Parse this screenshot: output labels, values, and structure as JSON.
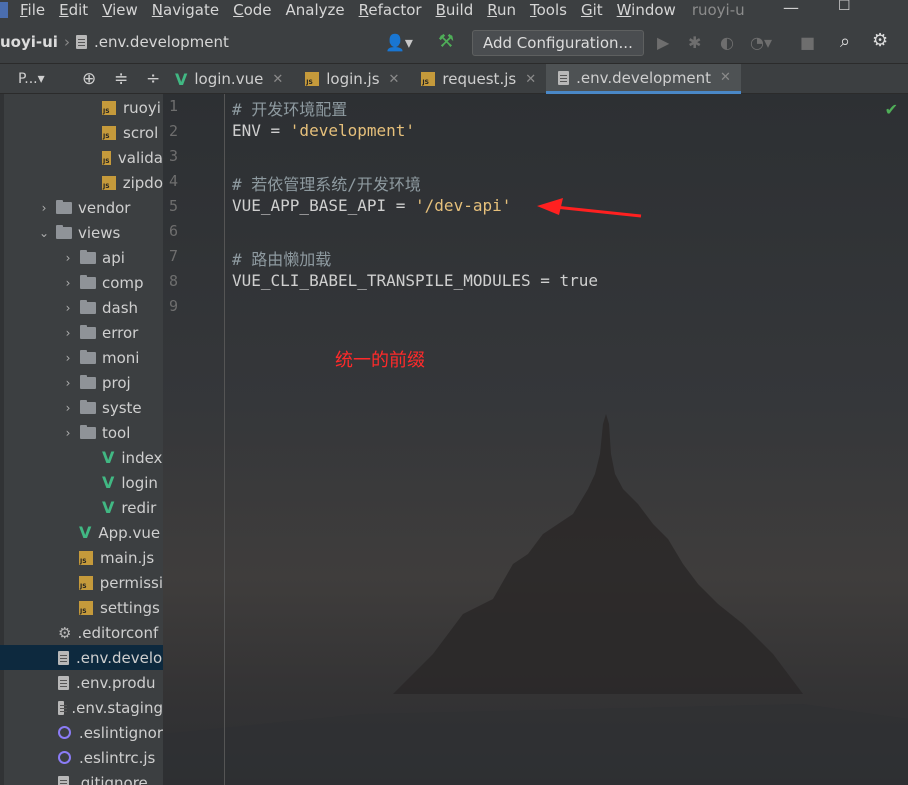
{
  "menubar": {
    "items": [
      {
        "label": "File",
        "u": "F",
        "rest": "ile"
      },
      {
        "label": "Edit",
        "u": "E",
        "rest": "dit"
      },
      {
        "label": "View",
        "u": "V",
        "rest": "iew"
      },
      {
        "label": "Navigate",
        "u": "N",
        "rest": "avigate"
      },
      {
        "label": "Code",
        "u": "C",
        "rest": "ode"
      },
      {
        "label": "Analyze",
        "u": "",
        "rest": "Analyze"
      },
      {
        "label": "Refactor",
        "u": "R",
        "rest": "efactor"
      },
      {
        "label": "Build",
        "u": "B",
        "rest": "uild"
      },
      {
        "label": "Run",
        "u": "R",
        "rest": "un"
      },
      {
        "label": "Tools",
        "u": "T",
        "rest": "ools"
      },
      {
        "label": "Git",
        "u": "G",
        "rest": "it"
      },
      {
        "label": "Window",
        "u": "W",
        "rest": "indow"
      }
    ],
    "project_title": "ruoyi-u"
  },
  "navbar": {
    "project": "uoyi-ui",
    "file": ".env.development",
    "config_button": "Add Configuration..."
  },
  "project_panel": {
    "tab_label": "P..."
  },
  "tabs": [
    {
      "label": "login.vue",
      "type": "vue"
    },
    {
      "label": "login.js",
      "type": "js"
    },
    {
      "label": "request.js",
      "type": "js"
    },
    {
      "label": ".env.development",
      "type": "file",
      "active": true
    }
  ],
  "tree": [
    {
      "label": "ruoyi",
      "type": "js",
      "indent": 3
    },
    {
      "label": "scrol",
      "type": "js",
      "indent": 3
    },
    {
      "label": "valida",
      "type": "js",
      "indent": 3
    },
    {
      "label": "zipdo",
      "type": "js",
      "indent": 3
    },
    {
      "label": "vendor",
      "type": "folder",
      "indent": 2,
      "arrow": "›"
    },
    {
      "label": "views",
      "type": "folder",
      "indent": 2,
      "arrow": "⌄"
    },
    {
      "label": "api",
      "type": "folder",
      "indent": 3,
      "arrow": "›"
    },
    {
      "label": "comp",
      "type": "folder",
      "indent": 3,
      "arrow": "›"
    },
    {
      "label": "dash",
      "type": "folder",
      "indent": 3,
      "arrow": "›"
    },
    {
      "label": "error",
      "type": "folder",
      "indent": 3,
      "arrow": "›"
    },
    {
      "label": "moni",
      "type": "folder",
      "indent": 3,
      "arrow": "›"
    },
    {
      "label": "proj",
      "type": "folder",
      "indent": 3,
      "arrow": "›"
    },
    {
      "label": "syste",
      "type": "folder",
      "indent": 3,
      "arrow": "›"
    },
    {
      "label": "tool",
      "type": "folder",
      "indent": 3,
      "arrow": "›"
    },
    {
      "label": "index",
      "type": "vue",
      "indent": 3
    },
    {
      "label": "login",
      "type": "vue",
      "indent": 3
    },
    {
      "label": "redir",
      "type": "vue",
      "indent": 3
    },
    {
      "label": "App.vue",
      "type": "vue",
      "indent": 2
    },
    {
      "label": "main.js",
      "type": "js",
      "indent": 2
    },
    {
      "label": "permissi",
      "type": "js",
      "indent": 2
    },
    {
      "label": "settings",
      "type": "js",
      "indent": 2
    },
    {
      "label": ".editorconf",
      "type": "gear",
      "indent": 1
    },
    {
      "label": ".env.develo",
      "type": "file",
      "indent": 1,
      "selected": true
    },
    {
      "label": ".env.produ",
      "type": "file",
      "indent": 1
    },
    {
      "label": ".env.staging",
      "type": "file",
      "indent": 1
    },
    {
      "label": ".eslintignor",
      "type": "ring",
      "indent": 1
    },
    {
      "label": ".eslintrc.js",
      "type": "ring",
      "indent": 1
    },
    {
      "label": ".gitignore",
      "type": "file",
      "indent": 1
    }
  ],
  "editor": {
    "line_numbers": [
      "1",
      "2",
      "3",
      "4",
      "5",
      "6",
      "7",
      "8",
      "9"
    ],
    "lines": [
      {
        "parts": [
          {
            "t": "# 开发环境配置",
            "c": "comment"
          }
        ]
      },
      {
        "parts": [
          {
            "t": "ENV = ",
            "c": "key"
          },
          {
            "t": "'development'",
            "c": "str"
          }
        ]
      },
      {
        "parts": []
      },
      {
        "parts": [
          {
            "t": "# 若依管理系统/开发环境",
            "c": "comment"
          }
        ]
      },
      {
        "parts": [
          {
            "t": "VUE_APP_BASE_API = ",
            "c": "key"
          },
          {
            "t": "'/dev-api'",
            "c": "str"
          }
        ]
      },
      {
        "parts": []
      },
      {
        "parts": [
          {
            "t": "# 路由懒加载",
            "c": "comment"
          }
        ]
      },
      {
        "parts": [
          {
            "t": "VUE_CLI_BABEL_TRANSPILE_MODULES = ",
            "c": "key"
          },
          {
            "t": "true",
            "c": "key"
          }
        ]
      },
      {
        "parts": []
      }
    ],
    "annotation": "统一的前缀",
    "annotation_color": "#ff2a2a"
  }
}
